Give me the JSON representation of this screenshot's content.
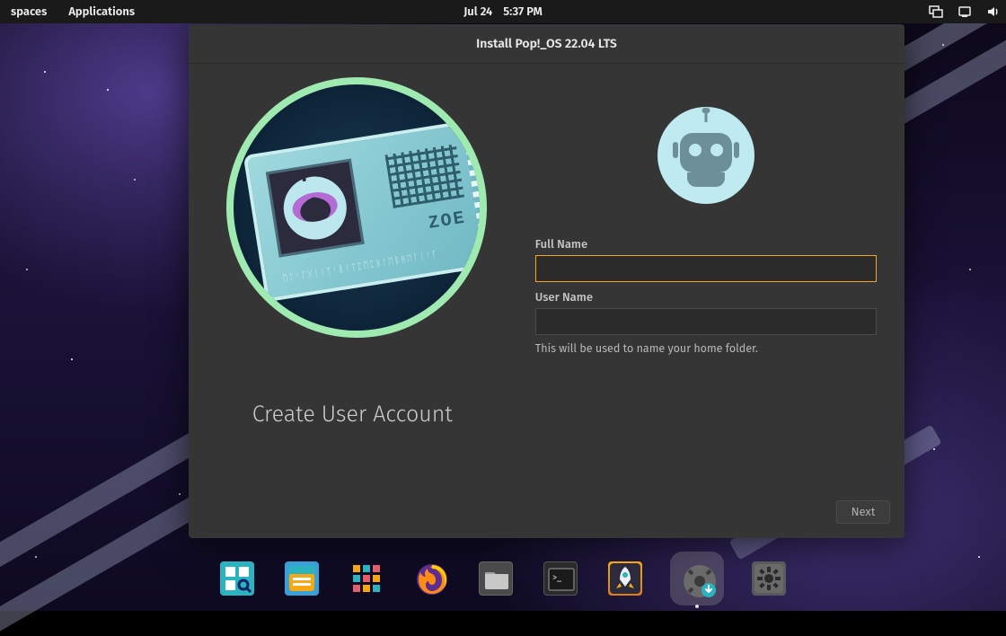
{
  "topbar": {
    "workspaces": "spaces",
    "applications": "Applications",
    "date": "Jul 24",
    "time": "5:37 PM"
  },
  "installer": {
    "title": "Install Pop!_OS 22.04 LTS",
    "step_title": "Create User Account",
    "badge_name": "ZOE",
    "badge_glyphs": "ᛖᛚᛌᚪᚷᛁᛁᛉᛌᛒᛁᛏᛈᛖᛈᛒᛚᛖᛒᚻᛖᛚᛁᛌᚪ",
    "full_name_label": "Full Name",
    "full_name_value": "",
    "user_name_label": "User Name",
    "user_name_value": "",
    "user_name_hint": "This will be used to name your home folder.",
    "next_label": "Next"
  },
  "dock": {
    "items": [
      {
        "name": "workspaces"
      },
      {
        "name": "files"
      },
      {
        "name": "applications"
      },
      {
        "name": "firefox"
      },
      {
        "name": "file-manager"
      },
      {
        "name": "terminal"
      },
      {
        "name": "pop-shop"
      },
      {
        "name": "installer"
      },
      {
        "name": "settings"
      }
    ]
  }
}
